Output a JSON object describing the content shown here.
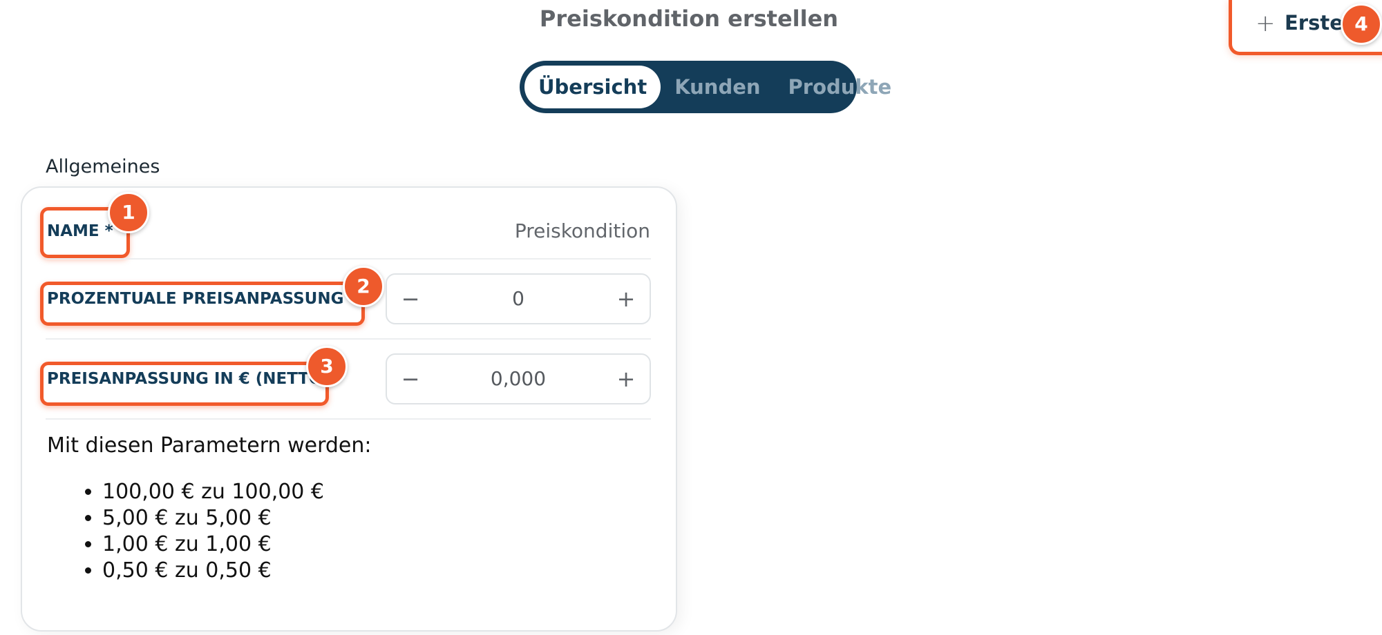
{
  "header": {
    "title": "Preiskondition erstellen",
    "create_button": {
      "icon": "plus-icon",
      "plus_glyph": "+",
      "label": "Erstelle"
    }
  },
  "tabs": [
    {
      "label": "Übersicht",
      "active": true
    },
    {
      "label": "Kunden",
      "active": false
    },
    {
      "label": "Produkte",
      "active": false
    }
  ],
  "section": {
    "title": "Allgemeines"
  },
  "form": {
    "name": {
      "label": "NAME *",
      "value": "Preiskondition"
    },
    "percent": {
      "label": "PROZENTUALE PREISANPASSUNG %",
      "value": "0",
      "minus": "−",
      "plus": "+"
    },
    "euro": {
      "label": "PREISANPASSUNG IN € (NETTO)",
      "value": "0,000",
      "minus": "−",
      "plus": "+"
    }
  },
  "summary": {
    "intro": "Mit diesen Parametern werden:",
    "items": [
      "100,00 € zu 100,00 €",
      "5,00 € zu 5,00 €",
      "1,00 € zu 1,00 €",
      "0,50 € zu 0,50 €"
    ]
  },
  "annotations": [
    "1",
    "2",
    "3",
    "4"
  ],
  "colors": {
    "accent": "#f15a2b",
    "navy": "#143d59",
    "badge": "#ee5a2c"
  }
}
